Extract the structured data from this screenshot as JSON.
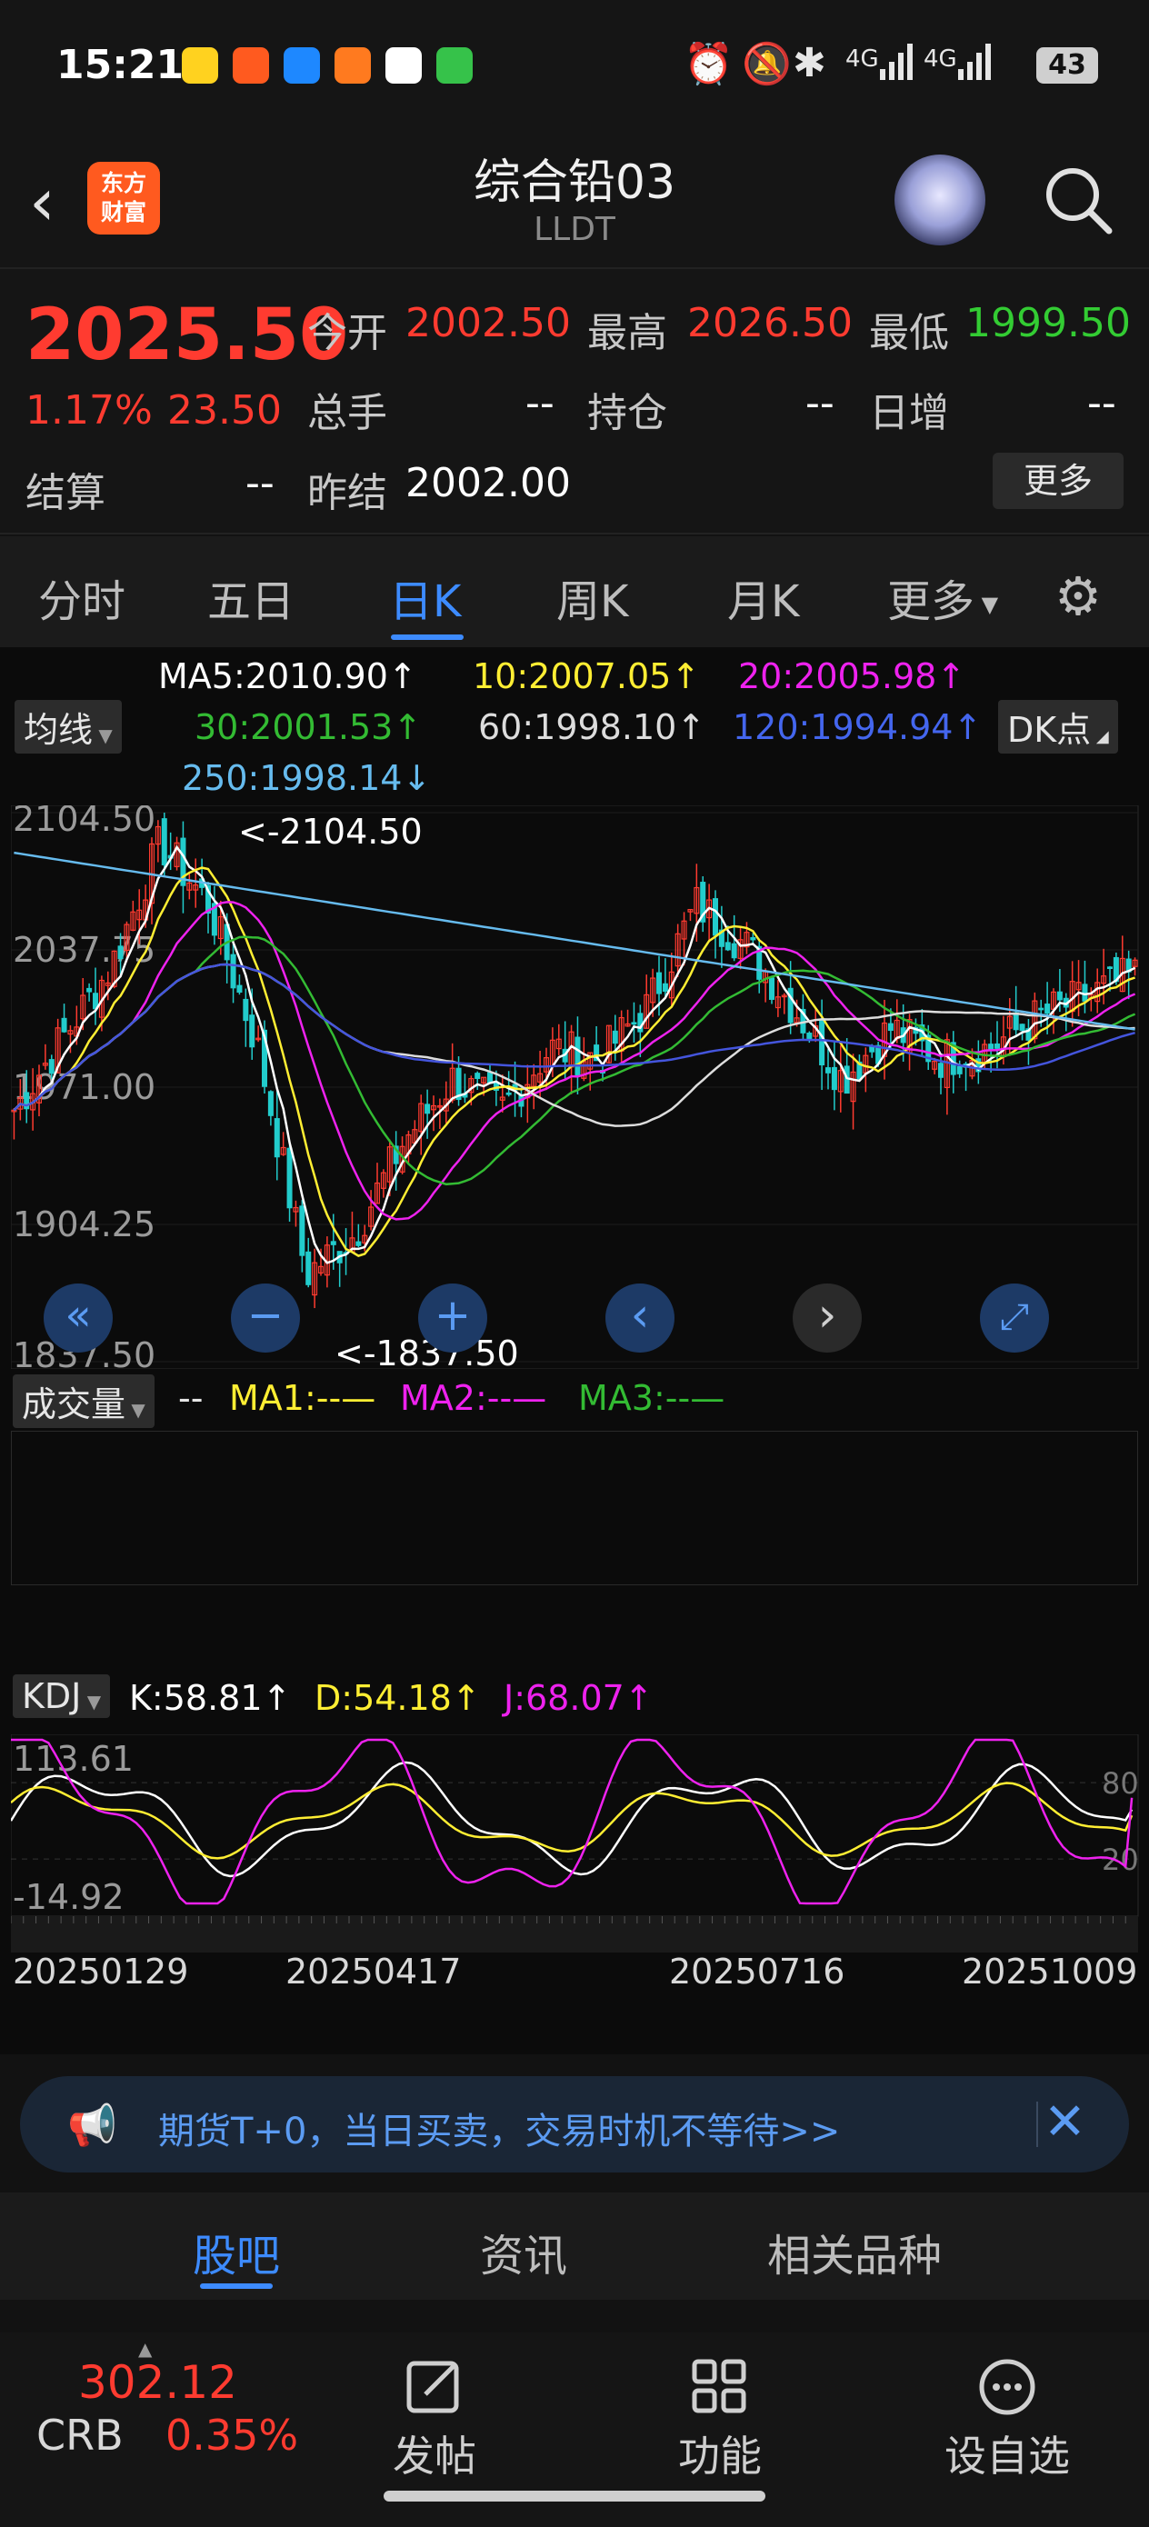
{
  "status_bar": {
    "time": "15:21",
    "network_1": "4G",
    "network_2": "4G",
    "battery": "43"
  },
  "nav": {
    "title": "综合铅03",
    "subtitle": "LLDT",
    "logo_line1": "东方",
    "logo_line2": "财富"
  },
  "quote": {
    "price": "2025.50",
    "change_pct": "1.17%",
    "change": "23.50",
    "open_label": "今开",
    "open": "2002.50",
    "high_label": "最高",
    "high": "2026.50",
    "low_label": "最低",
    "low": "1999.50",
    "volume_label": "总手",
    "volume": "--",
    "position_label": "持仓",
    "position": "--",
    "daily_inc_label": "日增",
    "daily_inc": "--",
    "settle_label": "结算",
    "settle": "--",
    "prev_settle_label": "昨结",
    "prev_settle": "2002.00",
    "more_label": "更多"
  },
  "tabs": {
    "t1": "分时",
    "t2": "五日",
    "t3": "日K",
    "t4": "周K",
    "t5": "月K",
    "t6": "更多"
  },
  "indicators": {
    "ma_select": "均线",
    "dk_select": "DK点",
    "ma5": "MA5:2010.90↑",
    "ma10": "10:2007.05↑",
    "ma20": "20:2005.98↑",
    "ma30": "30:2001.53↑",
    "ma60": "60:1998.10↑",
    "ma120": "120:1994.94↑",
    "ma250": "250:1998.14↓",
    "vol_select": "成交量",
    "vol_value": "--",
    "vol_ma1": "MA1:--",
    "vol_ma2": "MA2:--",
    "vol_ma3": "MA3:--",
    "kdj_select": "KDJ",
    "k": "K:58.81↑",
    "d": "D:54.18↑",
    "j": "J:68.07↑"
  },
  "colors": {
    "ma5": "#ffffff",
    "ma10": "#ffee33",
    "ma20": "#ee22ee",
    "ma30": "#33bb33",
    "ma60": "#dddddd",
    "ma120": "#4455dd",
    "ma250": "#66bbee",
    "up": "#ff3b30",
    "down": "#22cccc",
    "accent": "#3d8bff"
  },
  "chart_data": [
    {
      "type": "candlestick",
      "title": "",
      "y_ticks": [
        "2104.50",
        "2037.75",
        "1971.00",
        "1904.25",
        "1837.50"
      ],
      "ylim": [
        1837.5,
        2104.5
      ],
      "x_ticks": [
        "20250129",
        "20250417",
        "20250716",
        "20251009"
      ],
      "max_marker": "<-2104.50",
      "min_marker": "<-1837.50",
      "approx_close_path": [
        1960,
        1995,
        2030,
        2090,
        2060,
        1990,
        1880,
        1900,
        1945,
        1975,
        1960,
        1990,
        1985,
        2010,
        2060,
        2040,
        2010,
        1975,
        2000,
        1985,
        1990,
        2005,
        2015,
        2025.5
      ]
    },
    {
      "type": "line",
      "title": "KDJ",
      "y_ticks": [
        "113.61",
        "-14.92"
      ],
      "ylim": [
        -14.92,
        113.61
      ],
      "ref_lines": [
        "80",
        "20"
      ],
      "series": [
        {
          "name": "K",
          "last": 58.81
        },
        {
          "name": "D",
          "last": 54.18
        },
        {
          "name": "J",
          "last": 68.07
        }
      ]
    }
  ],
  "chart_controls": {
    "fast_back": "«",
    "zoom_out": "−",
    "zoom_in": "+",
    "prev": "‹",
    "next": "›",
    "fullscreen": "⤢"
  },
  "banner": {
    "text": "期货T+0，当日买卖，交易时机不等待>>",
    "close": "✕"
  },
  "subtabs": {
    "s1": "股吧",
    "s2": "资讯",
    "s3": "相关品种"
  },
  "bottom_bar": {
    "crb_value": "302.12",
    "crb_name": "CRB",
    "crb_pct": "0.35%",
    "post_label": "发帖",
    "function_label": "功能",
    "watch_label": "设自选"
  }
}
